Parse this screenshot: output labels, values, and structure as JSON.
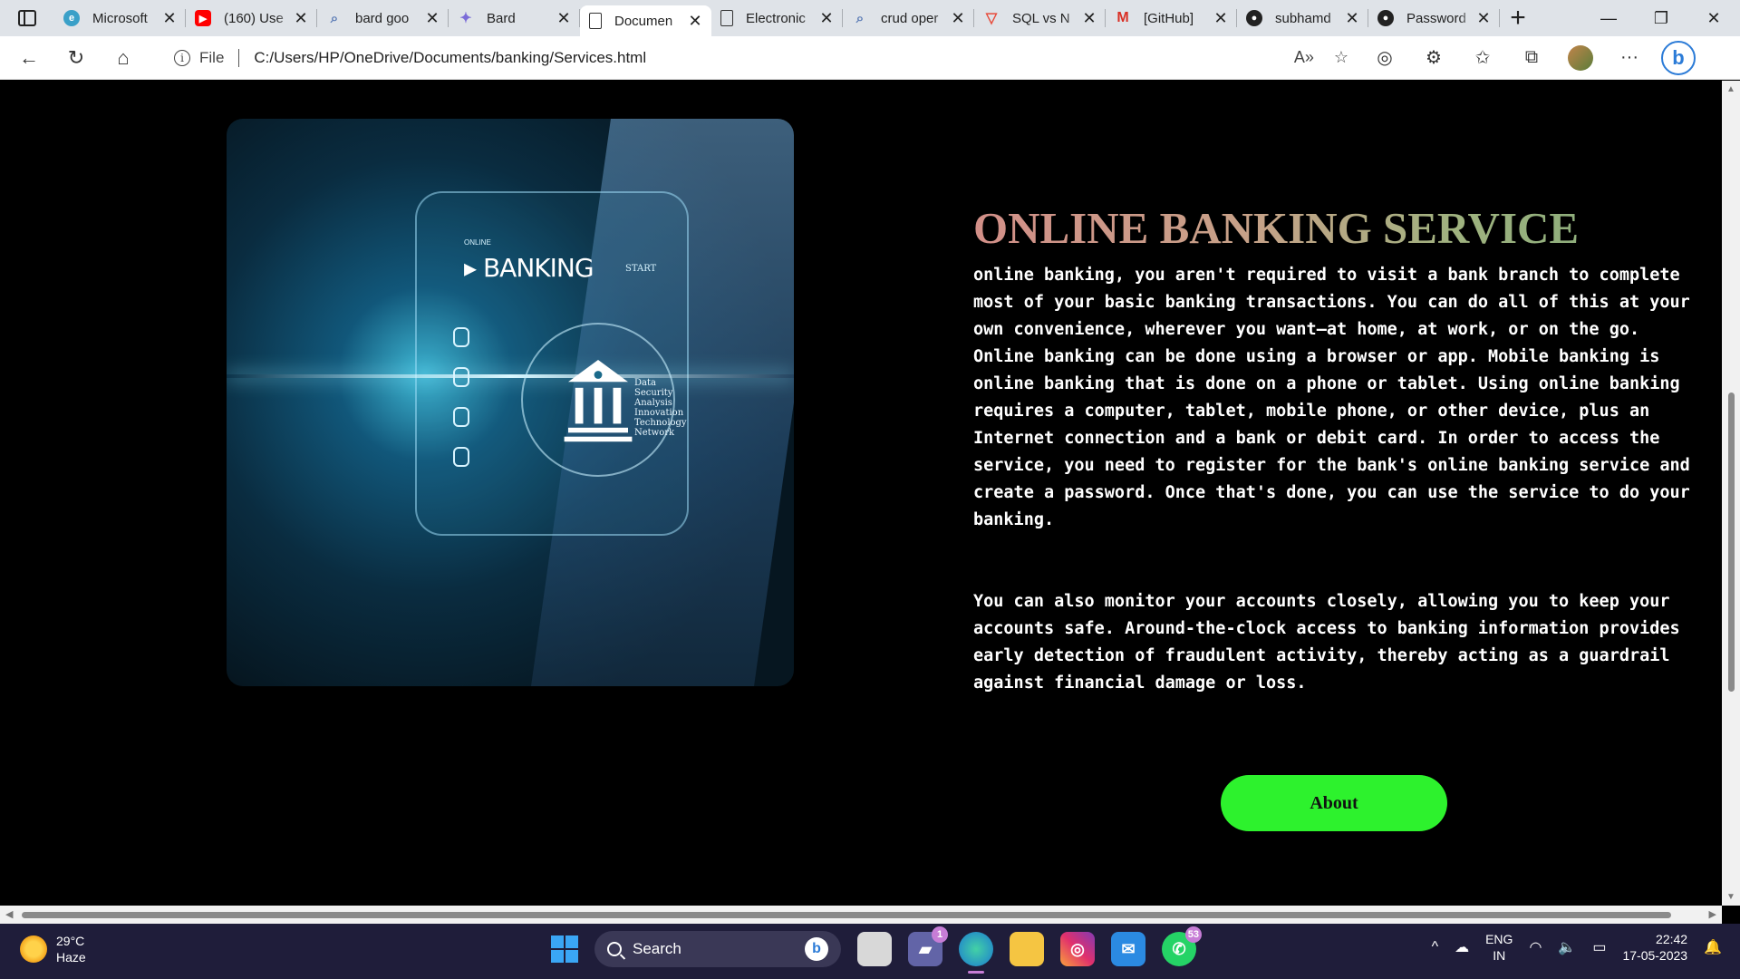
{
  "browser": {
    "tabs": [
      {
        "label": "Microsoft",
        "favicon": "edge-swirl-icon",
        "color": "#3aa0c8",
        "active": false
      },
      {
        "label": "(160) Use",
        "favicon": "youtube-icon",
        "color": "#ff0000",
        "active": false
      },
      {
        "label": "bard goo",
        "favicon": "search-icon",
        "color": "#5a7bb5",
        "active": false
      },
      {
        "label": "Bard",
        "favicon": "bard-sparkle-icon",
        "color": "#7b6cd8",
        "active": false
      },
      {
        "label": "Documen",
        "favicon": "document-icon",
        "color": "#555555",
        "active": true
      },
      {
        "label": "Electronic",
        "favicon": "document-icon",
        "color": "#555555",
        "active": false
      },
      {
        "label": "crud oper",
        "favicon": "search-icon",
        "color": "#5a7bb5",
        "active": false
      },
      {
        "label": "SQL vs N",
        "favicon": "vercel-triangle-icon",
        "color": "#e74c3c",
        "active": false
      },
      {
        "label": "[GitHub]",
        "favicon": "gmail-icon",
        "color": "#d93025",
        "active": false
      },
      {
        "label": "subhamd",
        "favicon": "github-icon",
        "color": "#222222",
        "active": false
      },
      {
        "label": "Password",
        "favicon": "github-icon",
        "color": "#222222",
        "active": false
      }
    ],
    "address": {
      "scheme_label": "File",
      "url": "C:/Users/HP/OneDrive/Documents/banking/Services.html"
    }
  },
  "page": {
    "title": "ONLINE BANKING SERVICE",
    "paragraphs": [
      "online banking, you aren't required to visit a bank branch to complete most of your basic banking transactions. You can do all of this at your own convenience, wherever you want—at home, at work, or on the go. Online banking can be done using a browser or app. Mobile banking is online banking that is done on a phone or tablet. Using online banking requires a computer, tablet, mobile phone, or other device, plus an Internet connection and a bank or debit card. In order to access the service, you need to register for the bank's online banking service and create a password. Once that's done, you can use the service to do your banking.",
      "You can also monitor your accounts closely, allowing you to keep your accounts safe. Around-the-clock access to banking information provides early detection of fraudulent activity, thereby acting as a guardrail against financial damage or loss."
    ],
    "about_button": "About",
    "image": {
      "online_label": "ONLINE",
      "banking_label": "BANKING",
      "start_label": "START",
      "list_items": [
        "Data",
        "Security",
        "Analysis",
        "Innovation",
        "Technology",
        "Network"
      ]
    }
  },
  "taskbar": {
    "weather": {
      "temp": "29°C",
      "condition": "Haze"
    },
    "search_placeholder": "Search",
    "apps": [
      {
        "name": "file-explorer-window-icon",
        "badge": ""
      },
      {
        "name": "teams-chat-icon",
        "badge": "1"
      },
      {
        "name": "edge-browser-icon",
        "badge": ""
      },
      {
        "name": "file-explorer-icon",
        "badge": ""
      },
      {
        "name": "instagram-icon",
        "badge": ""
      },
      {
        "name": "mail-icon",
        "badge": ""
      },
      {
        "name": "whatsapp-icon",
        "badge": "53"
      }
    ],
    "tray": {
      "lang_top": "ENG",
      "lang_bottom": "IN",
      "time": "22:42",
      "date": "17-05-2023"
    }
  }
}
